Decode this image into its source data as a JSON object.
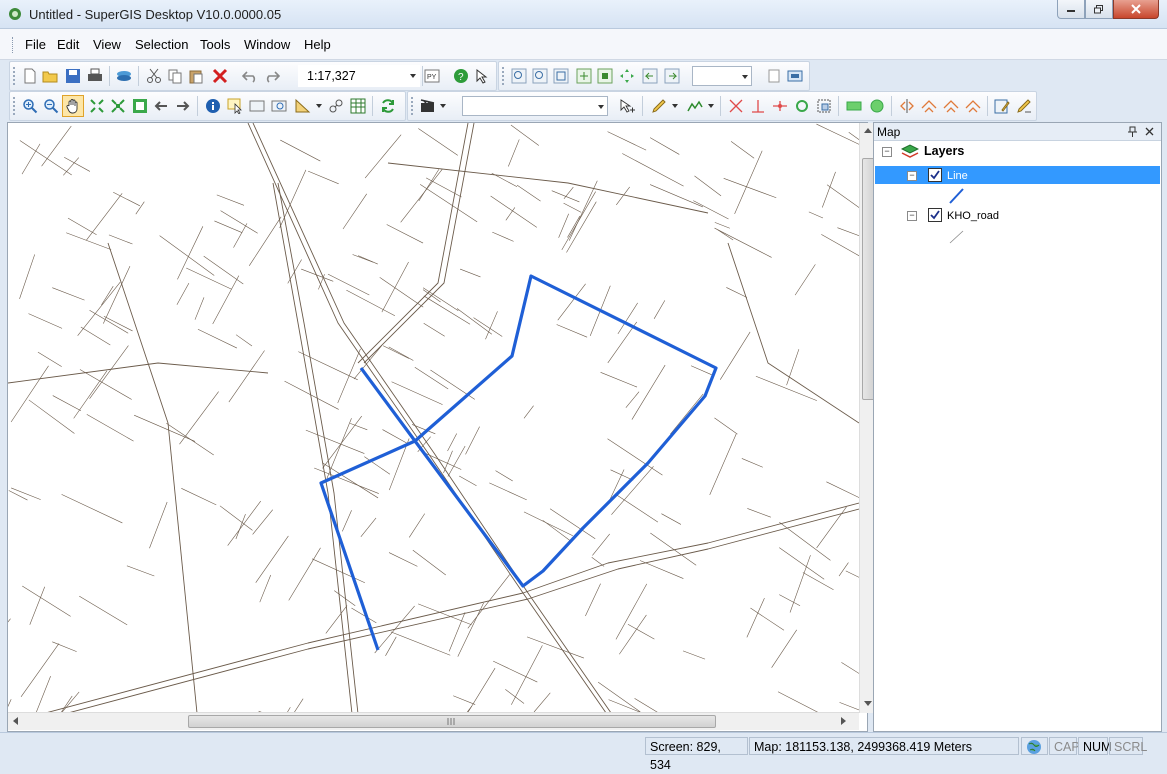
{
  "window": {
    "title": "Untitled - SuperGIS Desktop V10.0.0000.05"
  },
  "menu": {
    "items": [
      "File",
      "Edit",
      "View",
      "Selection",
      "Tools",
      "Window",
      "Help"
    ]
  },
  "toolbar": {
    "scale_value": "1:17,327",
    "scale_dropdown": "chevron-down-icon"
  },
  "toc": {
    "panel_title": "Map",
    "root_label": "Layers",
    "layers": [
      {
        "name": "Line",
        "checked": true,
        "selected": true,
        "color": "#1f5fd6"
      },
      {
        "name": "KHO_road",
        "checked": true,
        "selected": false,
        "color": "#7a6a5a"
      }
    ]
  },
  "map": {
    "road_color": "#6b5b4b",
    "highlight_color": "#1f5fd6"
  },
  "status": {
    "screen": "Screen: 829, 534",
    "map": "Map: 181153.138, 2499368.419 Meters",
    "cap": "CAP",
    "num": "NUM",
    "scrl": "SCRL"
  }
}
